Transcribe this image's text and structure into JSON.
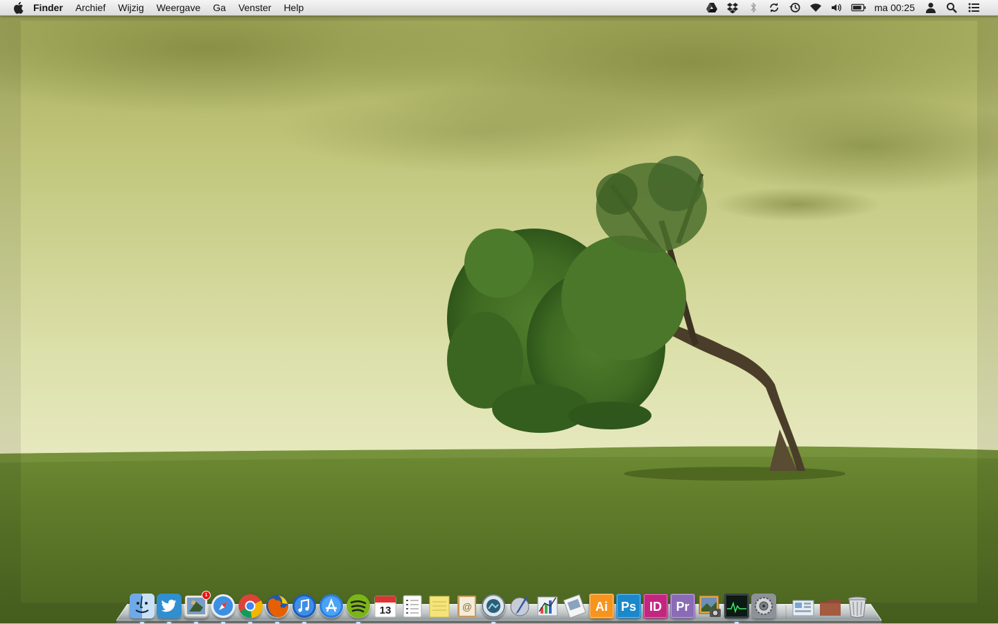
{
  "menubar": {
    "apple_icon": "apple-logo-icon",
    "app_name": "Finder",
    "menus": [
      "Archief",
      "Wijzig",
      "Weergave",
      "Ga",
      "Venster",
      "Help"
    ],
    "status_icons": [
      "google-drive-icon",
      "dropbox-icon",
      "bluetooth-icon",
      "sync-icon",
      "time-machine-icon",
      "wifi-icon",
      "volume-icon",
      "battery-icon"
    ],
    "clock": "ma 00:25",
    "trailing_icons": [
      "user-icon",
      "spotlight-search-icon",
      "notification-list-icon"
    ]
  },
  "dock": {
    "apps": [
      {
        "name": "finder-icon",
        "running": true
      },
      {
        "name": "twitter-icon",
        "running": true
      },
      {
        "name": "mail-icon",
        "running": true,
        "badge": "1"
      },
      {
        "name": "safari-icon",
        "running": true
      },
      {
        "name": "chrome-icon",
        "running": true
      },
      {
        "name": "firefox-icon",
        "running": true
      },
      {
        "name": "itunes-icon",
        "running": true
      },
      {
        "name": "app-store-icon",
        "running": false
      },
      {
        "name": "spotify-icon",
        "running": true
      },
      {
        "name": "calendar-icon",
        "running": false,
        "label": "13"
      },
      {
        "name": "reminders-icon",
        "running": false
      },
      {
        "name": "notes-icon",
        "running": false
      },
      {
        "name": "contacts-icon",
        "running": false
      },
      {
        "name": "iphoto-icon",
        "running": true
      },
      {
        "name": "script-editor-icon",
        "running": false
      },
      {
        "name": "grapher-icon",
        "running": false
      },
      {
        "name": "preview-icon",
        "running": false
      },
      {
        "name": "illustrator-icon",
        "running": false,
        "label": "Ai"
      },
      {
        "name": "photoshop-icon",
        "running": false,
        "label": "Ps"
      },
      {
        "name": "indesign-icon",
        "running": false,
        "label": "ID"
      },
      {
        "name": "premiere-icon",
        "running": false,
        "label": "Pr"
      },
      {
        "name": "image-capture-icon",
        "running": false
      },
      {
        "name": "activity-monitor-icon",
        "running": true
      },
      {
        "name": "system-preferences-icon",
        "running": false
      }
    ],
    "stacks": [
      {
        "name": "applications-stack-icon"
      },
      {
        "name": "documents-stack-icon"
      },
      {
        "name": "trash-icon"
      }
    ]
  },
  "colors": {
    "sky": "#d8dc9e",
    "grass": "#5e7a2a",
    "tree": "#3f6a22",
    "menubar": "#ececec"
  }
}
